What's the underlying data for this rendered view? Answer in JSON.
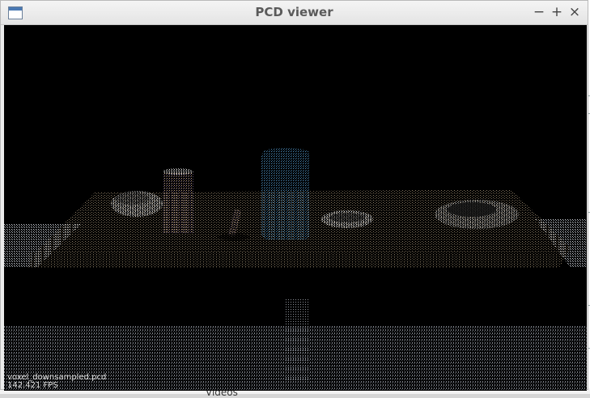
{
  "window": {
    "title": "PCD viewer",
    "minimize_symbol": "−",
    "maximize_symbol": "+",
    "close_symbol": "×",
    "icon": "app-window-icon"
  },
  "viewer": {
    "background_color": "#000000",
    "filename": "voxel_downsampled.pcd",
    "fps": "142.421 FPS"
  },
  "background_window": {
    "label": "Videos"
  },
  "colors": {
    "table_points": "#8a7a62",
    "floor_points": "#7c8088",
    "can_points": "#4a8ab8",
    "cup_points": "#b89a7a",
    "bowl_points": "#e8e8e8"
  }
}
